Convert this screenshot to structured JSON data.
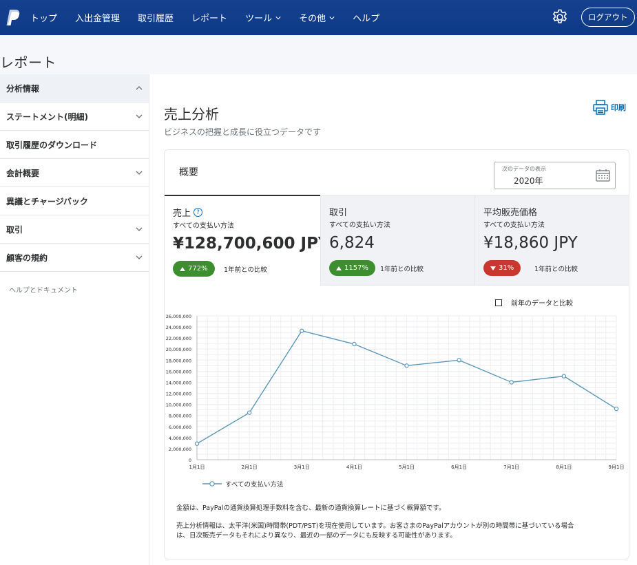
{
  "nav": {
    "items": [
      {
        "label": "トップ",
        "dropdown": false
      },
      {
        "label": "入出金管理",
        "dropdown": false
      },
      {
        "label": "取引履歴",
        "dropdown": false
      },
      {
        "label": "レポート",
        "dropdown": false
      },
      {
        "label": "ツール",
        "dropdown": true
      },
      {
        "label": "その他",
        "dropdown": true
      },
      {
        "label": "ヘルプ",
        "dropdown": false
      }
    ],
    "logout_label": "ログアウト"
  },
  "page": {
    "title": "レポート"
  },
  "sidebar": {
    "items": [
      {
        "label": "分析情報",
        "chevron": "up",
        "active": true
      },
      {
        "label": "ステートメント(明細)",
        "chevron": "down",
        "active": false
      },
      {
        "label": "取引履歴のダウンロード",
        "chevron": "none",
        "active": false
      },
      {
        "label": "会計概要",
        "chevron": "down",
        "active": false
      },
      {
        "label": "異議とチャージバック",
        "chevron": "none",
        "active": false
      },
      {
        "label": "取引",
        "chevron": "down",
        "active": false
      },
      {
        "label": "顧客の規約",
        "chevron": "down",
        "active": false
      }
    ],
    "help_link": "ヘルプとドキュメント"
  },
  "main": {
    "title": "売上分析",
    "subtitle": "ビジネスの把握と成長に役立つデータです",
    "print_label": "印刷"
  },
  "overview": {
    "title": "概要",
    "date_label": "次のデータの表示",
    "date_value": "2020年"
  },
  "tabs": [
    {
      "name": "売上",
      "has_help": true,
      "sub": "すべての支払い方法",
      "value": "¥128,700,600 JPY",
      "change": "772%",
      "direction": "up",
      "compare": "1年前との比較"
    },
    {
      "name": "取引",
      "has_help": false,
      "sub": "すべての支払い方法",
      "value": "6,824",
      "change": "1157%",
      "direction": "up",
      "compare": "1年前との比較"
    },
    {
      "name": "平均販売価格",
      "has_help": false,
      "sub": "すべての支払い方法",
      "value": "¥18,860 JPY",
      "change": "31%",
      "direction": "down",
      "compare": "1年前との比較"
    }
  ],
  "compare_label": "前年のデータと比較",
  "colors": {
    "nav": "#0f3d8a",
    "line": "#5b97b8",
    "up": "#3c8e2e",
    "down": "#c8382f",
    "link": "#0070ba"
  },
  "chart_data": {
    "type": "line",
    "categories": [
      "1月1日",
      "2月1日",
      "3月1日",
      "4月1日",
      "5月1日",
      "6月1日",
      "7月1日",
      "8月1日",
      "9月1日"
    ],
    "series": [
      {
        "name": "すべての支払い方法",
        "values": [
          2900000,
          8500000,
          23300000,
          20900000,
          17000000,
          18000000,
          14000000,
          15100000,
          9200000
        ]
      }
    ],
    "ylim": [
      0,
      26000000
    ],
    "yticks": [
      "0",
      "2,000,000",
      "4,000,000",
      "6,000,000",
      "8,000,000",
      "10,000,000",
      "12,000,000",
      "14,000,000",
      "16,000,000",
      "18,000,000",
      "20,000,000",
      "22,000,000",
      "24,000,000",
      "26,000,000"
    ],
    "grid": true,
    "legend": "bottom-left"
  },
  "notes": {
    "line1": "金額は、PayPalの通貨換算処理手数料を含む、最新の通貨換算レートに基づく概算額です。",
    "line2": "売上分析情報は、太平洋(米国)時間帯(PDT/PST)を現在使用しています。お客さまのPayPalアカウントが別の時間帯に基づいている場合は、日次販売データもそれにより異なり、最近の一部のデータにも反映する可能性があります。"
  }
}
